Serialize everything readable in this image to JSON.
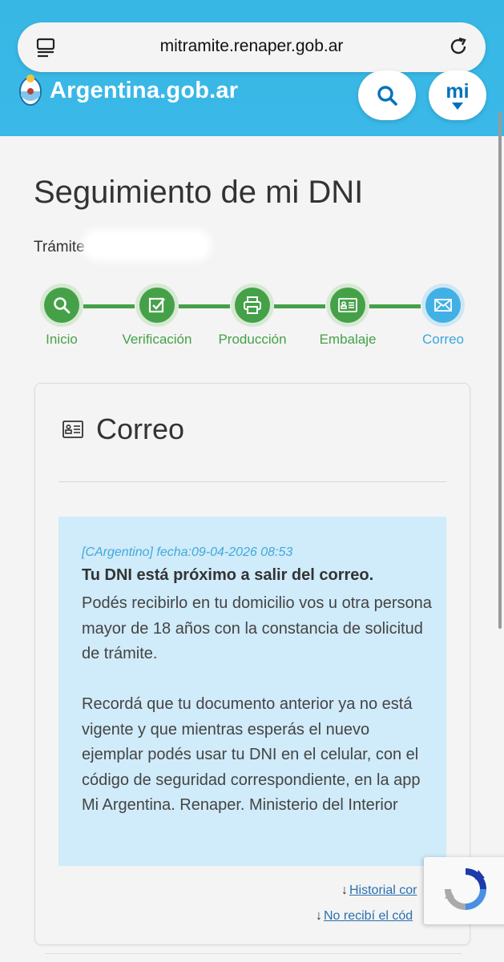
{
  "browser": {
    "url": "mitramite.renaper.gob.ar"
  },
  "header": {
    "brand": "Argentina.gob.ar",
    "mi_label": "mi"
  },
  "page": {
    "title": "Seguimiento de mi DNI",
    "tramite_label": "Trámite"
  },
  "steps": [
    {
      "label": "Inicio",
      "icon": "search-icon",
      "state": "done"
    },
    {
      "label": "Verificación",
      "icon": "checkbox-icon",
      "state": "done"
    },
    {
      "label": "Producción",
      "icon": "printer-icon",
      "state": "done"
    },
    {
      "label": "Embalaje",
      "icon": "id-card-icon",
      "state": "done"
    },
    {
      "label": "Correo",
      "icon": "mail-icon",
      "state": "current"
    }
  ],
  "card": {
    "title": "Correo",
    "notice": {
      "meta": "[CArgentino] fecha:09-04-2026 08:53",
      "headline": "Tu DNI está próximo a salir del correo.",
      "body": "Podés recibirlo en tu domicilio vos u otra persona mayor de 18 años con la constancia de solicitud de trámite.\n\nRecordá que tu documento anterior ya no está vigente y que mientras esperás el nuevo ejemplar podés usar tu DNI en el celular, con el código de seguridad correspondiente, en la app Mi Argentina. Renaper. Ministerio del Interior"
    },
    "links": {
      "historial": "Historial cor",
      "no_recibi": "No recibí el cód"
    }
  },
  "colors": {
    "header": "#3ab9e8",
    "step_done": "#45a148",
    "step_current": "#41b0e5",
    "notice_bg": "#d0ebf9"
  }
}
